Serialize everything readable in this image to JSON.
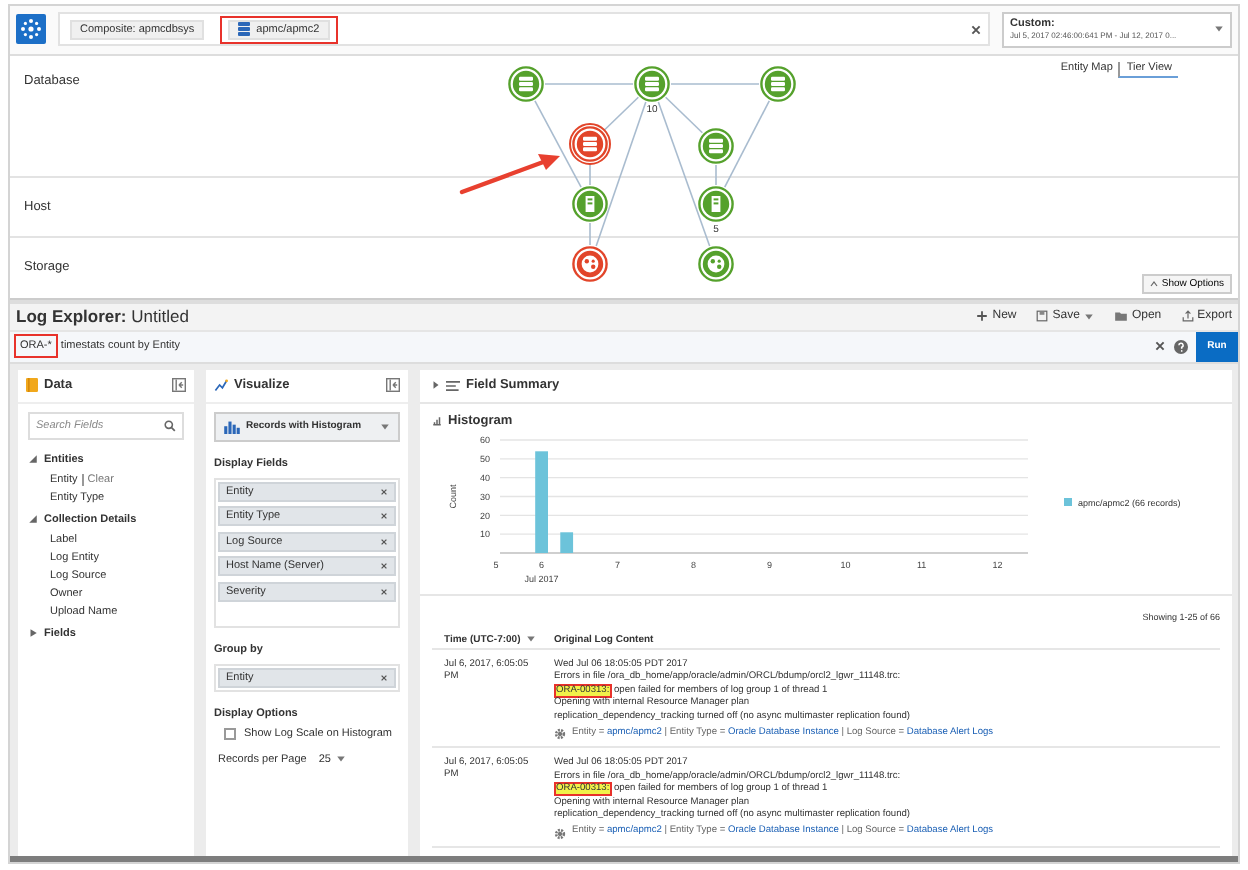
{
  "top_bar": {
    "tabs": [
      {
        "label": "Composite: apmcdbsys",
        "kind": "composite",
        "annotated": false
      },
      {
        "label": "apmc/apmc2",
        "kind": "entity",
        "annotated": true
      }
    ],
    "time_range": {
      "label": "Custom:",
      "value": "Jul 5, 2017 02:46:00:641 PM - Jul 12, 2017 0..."
    }
  },
  "topology": {
    "views": [
      {
        "label": "Entity Map",
        "selected": false
      },
      {
        "label": "Tier View",
        "selected": true
      }
    ],
    "tiers": [
      {
        "label": "Database"
      },
      {
        "label": "Host"
      },
      {
        "label": "Storage"
      }
    ],
    "nodes": [
      {
        "kind": "database",
        "color": "#55a12c",
        "selected": false
      },
      {
        "kind": "database",
        "color": "#55a12c",
        "selected": false,
        "count": "10"
      },
      {
        "kind": "database",
        "color": "#55a12c",
        "selected": false
      },
      {
        "kind": "database",
        "color": "#e2452a",
        "selected": true
      },
      {
        "kind": "database",
        "color": "#55a12c",
        "selected": false
      },
      {
        "kind": "host",
        "color": "#55a12c",
        "selected": false
      },
      {
        "kind": "host",
        "color": "#55a12c",
        "selected": false,
        "count": "5"
      },
      {
        "kind": "storage",
        "color": "#e2452a",
        "selected": false
      },
      {
        "kind": "storage",
        "color": "#55a12c",
        "selected": false
      }
    ],
    "show_options": "Show Options"
  },
  "log_explorer": {
    "title": "**Log Explorer:** Untitled",
    "actions": [
      {
        "label": "New",
        "kind": "new"
      },
      {
        "label": "Save",
        "kind": "save"
      },
      {
        "label": "Open",
        "kind": "open"
      },
      {
        "label": "Export",
        "kind": "export"
      }
    ],
    "query": {
      "annotated_part": "ORA-*",
      "text": "timestats count by Entity"
    },
    "run": "Run"
  },
  "data_panel": {
    "title": "Data",
    "search_placeholder": "Search Fields",
    "groups": [
      {
        "label": "Entities",
        "expanded": true,
        "children": [
          {
            "label": "Entity",
            "link": "Clear"
          },
          {
            "label": "Entity Type"
          }
        ]
      },
      {
        "label": "Collection Details",
        "expanded": true,
        "children": [
          {
            "label": "Label"
          },
          {
            "label": "Log Entity"
          },
          {
            "label": "Log Source"
          },
          {
            "label": "Owner"
          },
          {
            "label": "Upload Name"
          }
        ]
      },
      {
        "label": "Fields",
        "expanded": false
      }
    ]
  },
  "visualize_panel": {
    "title": "Visualize",
    "chart_type": "Records with Histogram",
    "display_fields_label": "Display Fields",
    "display_fields": [
      {
        "label": "Entity"
      },
      {
        "label": "Entity Type"
      },
      {
        "label": "Log Source"
      },
      {
        "label": "Host Name (Server)"
      },
      {
        "label": "Severity"
      }
    ],
    "group_by_label": "Group by",
    "group_by": [
      {
        "label": "Entity"
      }
    ],
    "options_label": "Display Options",
    "log_scale": {
      "label": "Show Log Scale on Histogram",
      "checked": false
    },
    "records_per_page": {
      "label": "Records per Page",
      "value": "25"
    }
  },
  "results": {
    "field_summary": "Field Summary",
    "histogram": {
      "title": "Histogram",
      "chart_data": {
        "type": "bar",
        "xlabel": "Jul 2017",
        "ylabel": "Count",
        "x": [
          6,
          6.33
        ],
        "series": [
          {
            "name": "apmc/apmc2 (66 records)",
            "color": "#6cc3da",
            "values": [
              54,
              11
            ]
          }
        ],
        "grid": true,
        "xlim": [
          5.4,
          12.4
        ],
        "ylim": [
          0,
          60
        ],
        "xticks": [
          {
            "value": 5.4,
            "label": "5"
          },
          6,
          7,
          8,
          9,
          10,
          11,
          12
        ],
        "yticks": [
          10,
          20,
          30,
          40,
          50,
          60
        ]
      }
    },
    "showing": "Showing 1-25 of 66",
    "columns": [
      {
        "label": "Time (UTC-7:00)",
        "sorted": true
      },
      {
        "label": "Original Log Content",
        "sorted": false
      }
    ],
    "rows": [
      {
        "time": "Jul 6, 2017, 6:05:05 PM",
        "lines": [
          {
            "text": "Wed Jul 06 18:05:05 PDT 2017"
          },
          {
            "text": "Errors in file /ora_db_home/app/oracle/admin/ORCL/bdump/orcl2_lgwr_11148.trc:"
          },
          {
            "match": "ORA-00313:",
            "text": " open failed for members of log group 1 of thread 1"
          },
          {
            "text": "Opening with internal Resource Manager plan"
          },
          {
            "text": "replication_dependency_tracking turned off (no async multimaster replication found)"
          }
        ],
        "meta": [
          {
            "label": "Entity =",
            "link": "apmc/apmc2"
          },
          {
            "label": "| Entity Type =",
            "link": "Oracle Database Instance"
          },
          {
            "label": "| Log Source =",
            "link": "Database Alert Logs"
          }
        ]
      },
      {
        "time": "Jul 6, 2017, 6:05:05 PM",
        "lines": [
          {
            "text": "Wed Jul 06 18:05:05 PDT 2017"
          },
          {
            "text": "Errors in file /ora_db_home/app/oracle/admin/ORCL/bdump/orcl2_lgwr_11148.trc:"
          },
          {
            "match": "ORA-00313:",
            "text": " open failed for members of log group 1 of thread 1"
          },
          {
            "text": "Opening with internal Resource Manager plan"
          },
          {
            "text": "replication_dependency_tracking turned off (no async multimaster replication found)"
          }
        ],
        "meta": [
          {
            "label": "Entity =",
            "link": "apmc/apmc2"
          },
          {
            "label": "| Entity Type =",
            "link": "Oracle Database Instance"
          },
          {
            "label": "| Log Source =",
            "link": "Database Alert Logs"
          }
        ]
      }
    ]
  }
}
